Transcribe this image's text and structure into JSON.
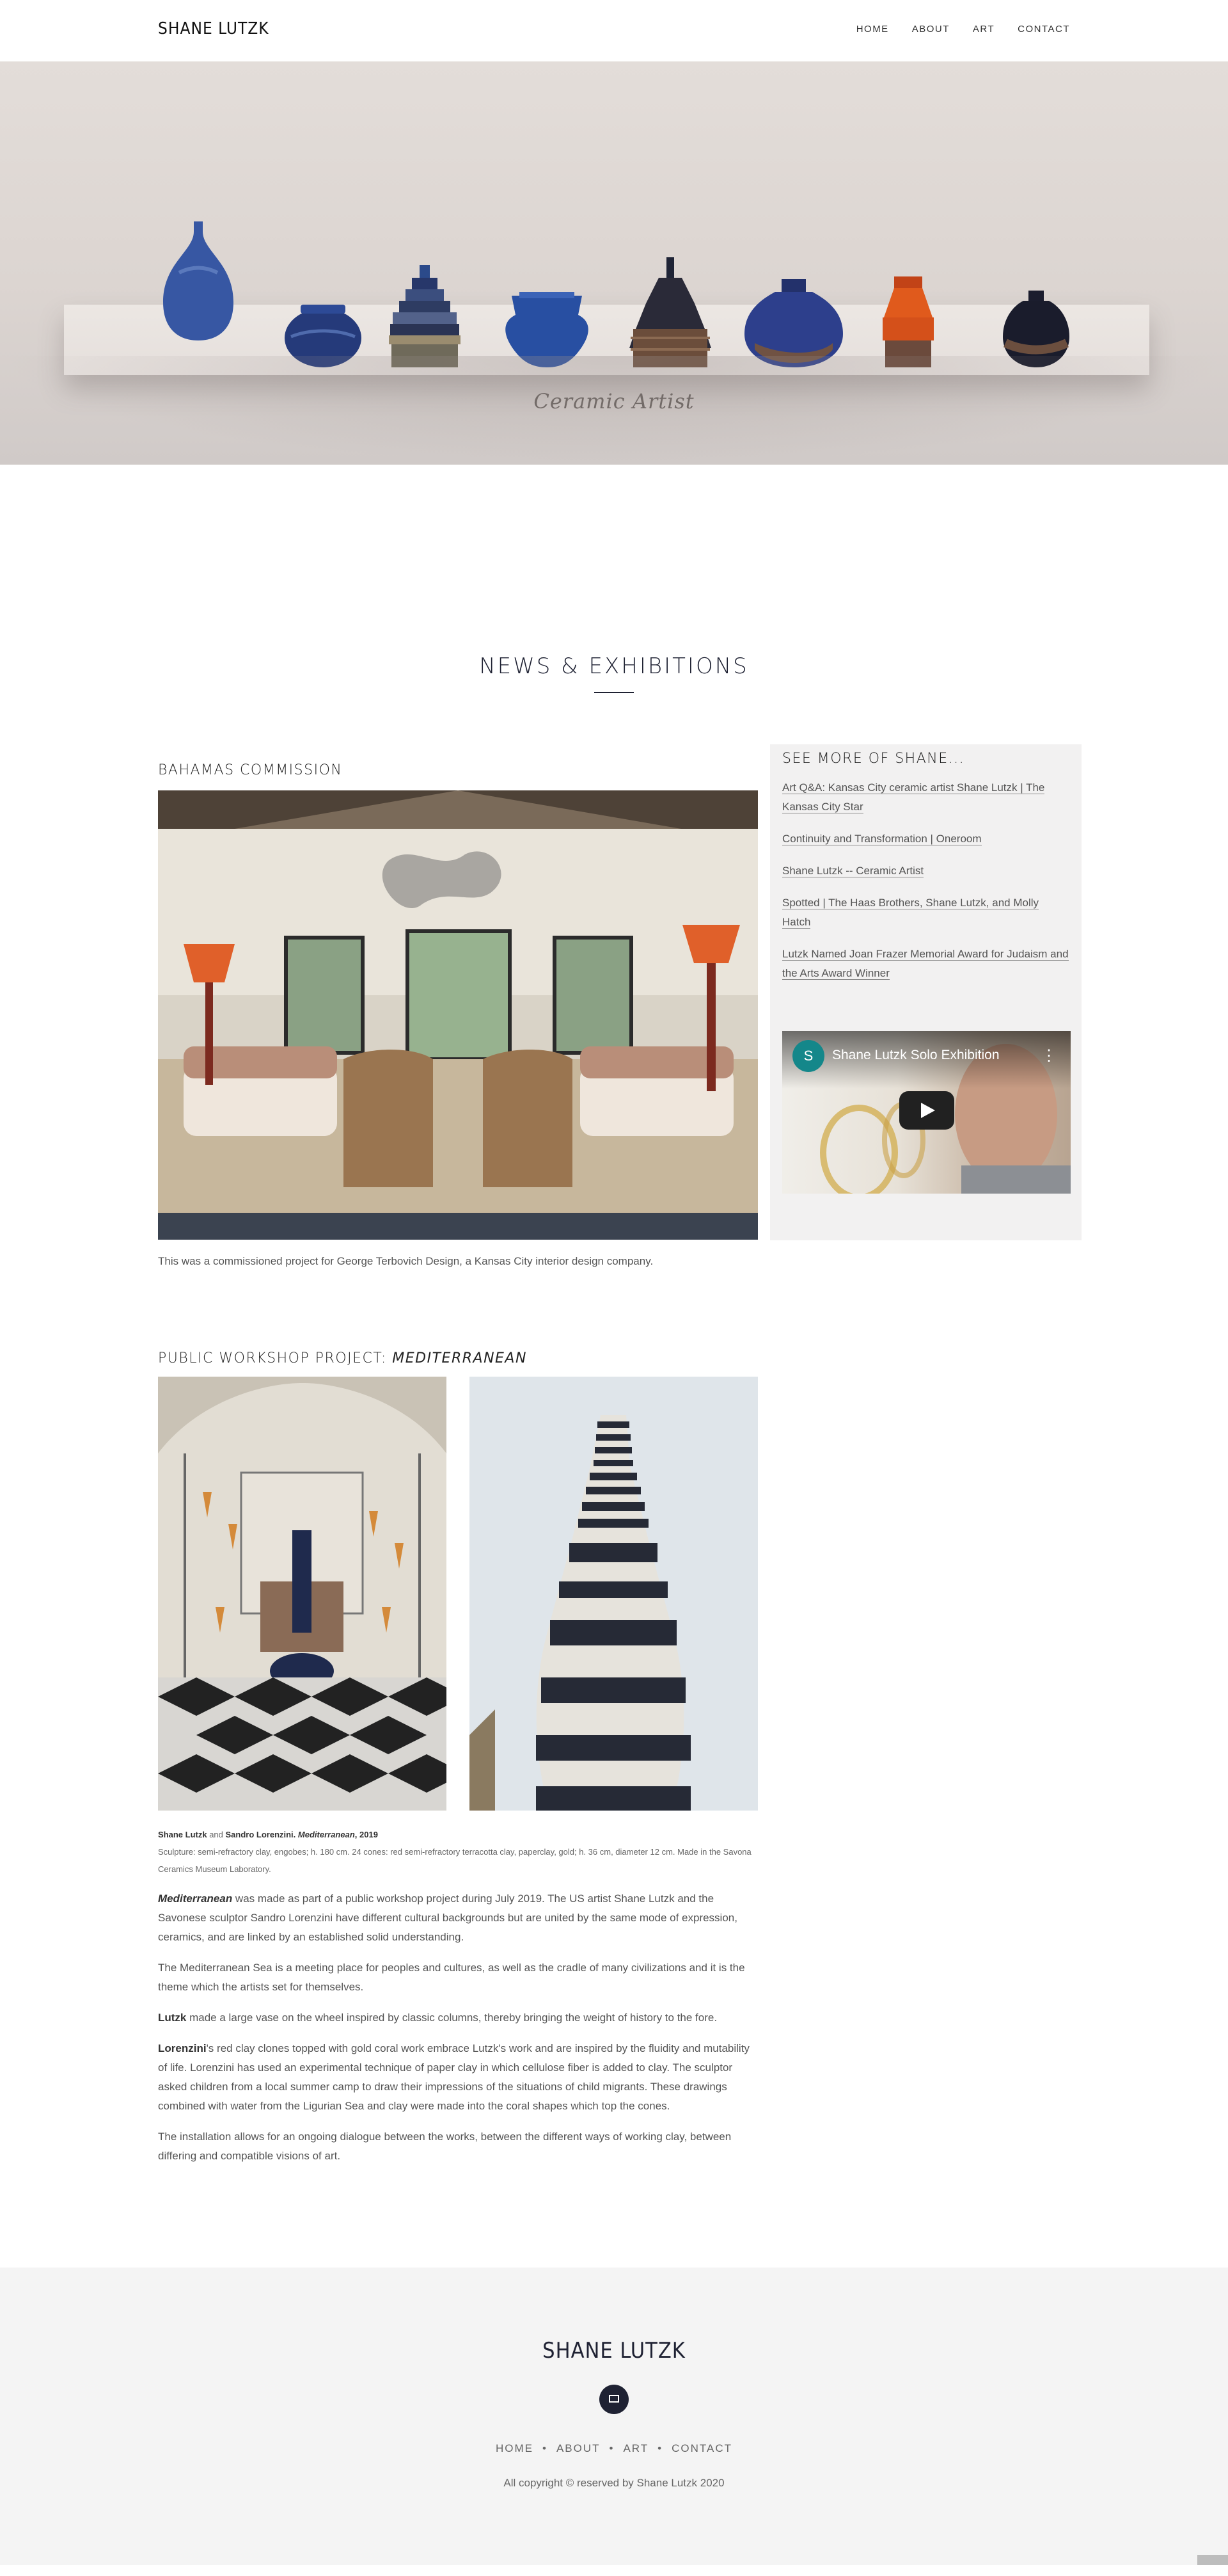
{
  "header": {
    "logo": "SHANE LUTZK",
    "nav": [
      "HOME",
      "ABOUT",
      "ART",
      "CONTACT"
    ]
  },
  "hero": {
    "caption": "Ceramic Artist"
  },
  "section": {
    "title": "NEWS & EXHIBITIONS"
  },
  "bahamas": {
    "title": "BAHAMAS COMMISSION",
    "caption": "This was a commissioned project for George Terbovich Design, a Kansas City interior design company."
  },
  "sidebar": {
    "title": "SEE MORE OF SHANE...",
    "links": [
      "Art Q&A: Kansas City ceramic artist Shane Lutzk | The Kansas City Star",
      "Continuity and Transformation | Oneroom",
      "Shane Lutzk -- Ceramic Artist",
      "Spotted | The Haas Brothers, Shane Lutzk, and Molly Hatch",
      "Lutzk Named Joan Frazer Memorial Award for Judaism and the Arts Award Winner"
    ],
    "video": {
      "avatar": "S",
      "title": "Shane Lutzk Solo Exhibition"
    }
  },
  "workshop": {
    "title_prefix": "PUBLIC WORKSHOP PROJECT: ",
    "title_em": "MEDITERRANEAN",
    "credit_a": "Shane Lutzk",
    "credit_and": " and ",
    "credit_b": "Sandro Lorenzini.",
    "credit_title": " Mediterranean",
    "credit_year": ", 2019",
    "materials": "Sculpture: semi-refractory clay, engobes; h. 180 cm. 24 cones: red semi-refractory terracotta clay, paperclay, gold; h. 36 cm, diameter 12 cm. Made in the Savona Ceramics Museum Laboratory.",
    "p1_bold": "Mediterranean",
    "p1": " was made as part of a public workshop project during July 2019. The US artist Shane Lutzk and the Savonese sculptor Sandro Lorenzini have different cultural backgrounds but are united by the same mode of expression, ceramics, and are linked by an established solid understanding.",
    "p2": "The Mediterranean Sea is a meeting place for peoples and cultures, as well as the cradle of many civilizations and it is the theme which the artists set for themselves.",
    "p3_bold": "Lutzk",
    "p3": " made a large vase on the wheel inspired by classic columns, thereby bringing the weight of history to the fore.",
    "p4_bold": "Lorenzini",
    "p4": "'s red clay clones topped with gold coral work embrace Lutzk's work and are inspired by the fluidity and mutability of life. Lorenzini has used an experimental technique of paper clay in which cellulose fiber is added to clay. The sculptor asked children from a local summer camp to draw their impressions of the situations of child migrants. These drawings combined with water from the Ligurian Sea and clay were made into the coral shapes which top the cones.",
    "p5": "The installation allows for an ongoing dialogue between the works, between the different ways of working clay, between differing and compatible visions of art."
  },
  "footer": {
    "logo": "SHANE LUTZK",
    "nav": [
      "HOME",
      "ABOUT",
      "ART",
      "CONTACT"
    ],
    "separator": "•",
    "copyright": "All copyright © reserved by Shane Lutzk 2020"
  }
}
